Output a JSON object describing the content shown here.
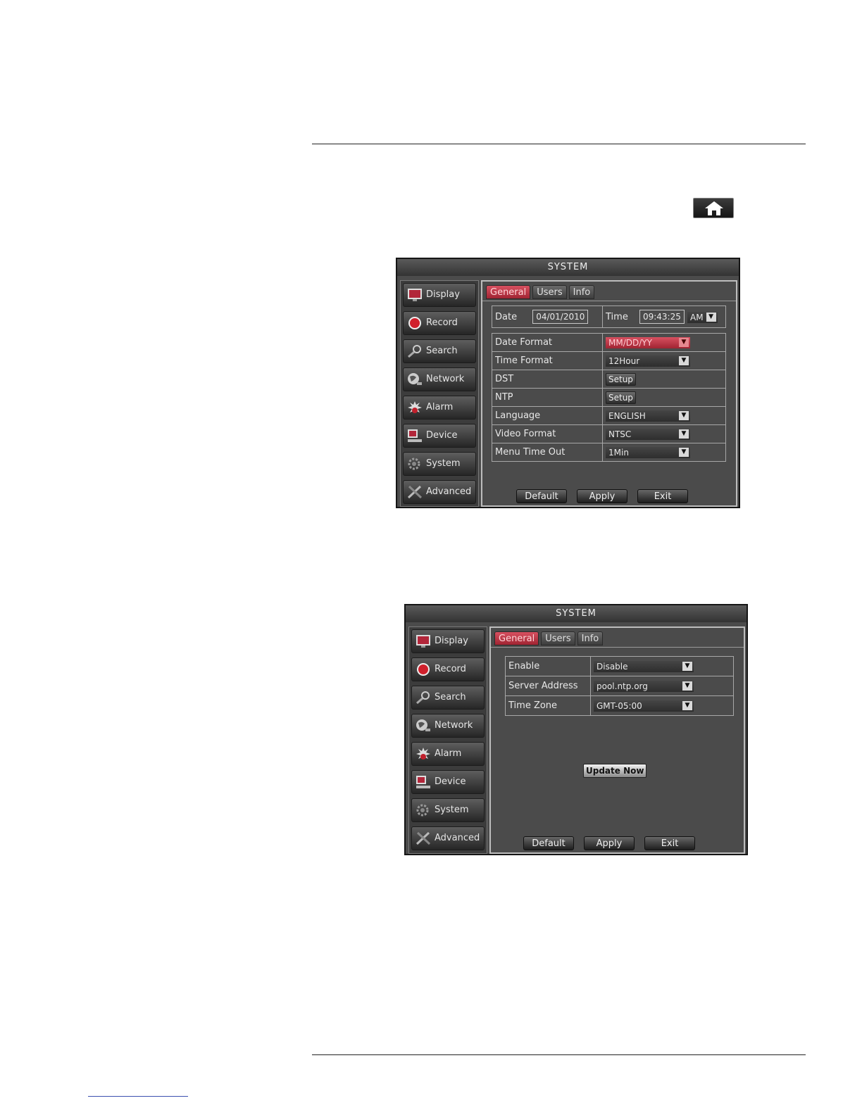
{
  "home_icon": "home-icon",
  "screen1": {
    "title": "SYSTEM",
    "sidebar": [
      {
        "label": "Display",
        "icon": "monitor-icon"
      },
      {
        "label": "Record",
        "icon": "record-icon"
      },
      {
        "label": "Search",
        "icon": "magnifier-icon"
      },
      {
        "label": "Network",
        "icon": "globe-icon"
      },
      {
        "label": "Alarm",
        "icon": "alarm-icon"
      },
      {
        "label": "Device",
        "icon": "device-icon"
      },
      {
        "label": "System",
        "icon": "gear-icon"
      },
      {
        "label": "Advanced",
        "icon": "tools-icon"
      }
    ],
    "tabs": [
      "General",
      "Users",
      "Info"
    ],
    "date_label": "Date",
    "date_value": "04/01/2010",
    "time_label": "Time",
    "time_value": "09:43:25",
    "ampm": "AM",
    "rows": [
      {
        "label": "Date Format",
        "value": "MM/DD/YY"
      },
      {
        "label": "Time Format",
        "value": "12Hour"
      },
      {
        "label": "DST",
        "value": "Setup"
      },
      {
        "label": "NTP",
        "value": "Setup"
      },
      {
        "label": "Language",
        "value": "ENGLISH"
      },
      {
        "label": "Video Format",
        "value": "NTSC"
      },
      {
        "label": "Menu Time Out",
        "value": "1Min"
      }
    ],
    "buttons": {
      "default": "Default",
      "apply": "Apply",
      "exit": "Exit"
    }
  },
  "screen2": {
    "title": "SYSTEM",
    "sidebar": [
      {
        "label": "Display"
      },
      {
        "label": "Record"
      },
      {
        "label": "Search"
      },
      {
        "label": "Network"
      },
      {
        "label": "Alarm"
      },
      {
        "label": "Device"
      },
      {
        "label": "System"
      },
      {
        "label": "Advanced"
      }
    ],
    "tabs": [
      "General",
      "Users",
      "Info"
    ],
    "rows": [
      {
        "label": "Enable",
        "value": "Disable"
      },
      {
        "label": "Server Address",
        "value": "pool.ntp.org"
      },
      {
        "label": "Time Zone",
        "value": "GMT-05:00"
      }
    ],
    "update_now": "Update Now",
    "buttons": {
      "default": "Default",
      "apply": "Apply",
      "exit": "Exit"
    }
  },
  "colors": {
    "accent_red": "#c03040",
    "window_bg": "#4b4b4b"
  }
}
